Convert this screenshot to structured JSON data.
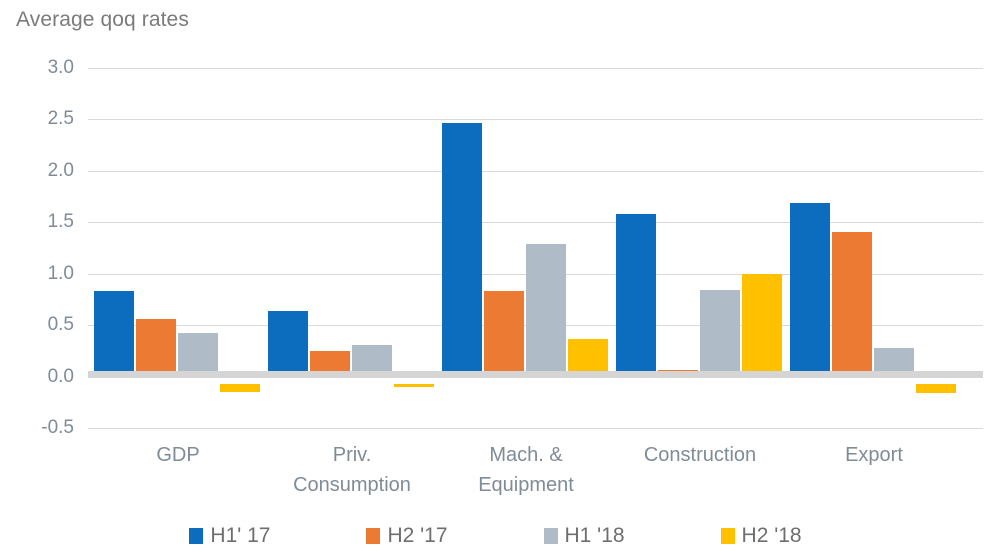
{
  "chart_data": {
    "type": "bar",
    "title": "Average qoq rates",
    "xlabel": "",
    "ylabel": "",
    "ylim": [
      -0.5,
      3.0
    ],
    "ytick_step": 0.5,
    "yticks": [
      "3.0",
      "2.5",
      "2.0",
      "1.5",
      "1.0",
      "0.5",
      "0.0",
      "-0.5"
    ],
    "ytick_values": [
      3.0,
      2.5,
      2.0,
      1.5,
      1.0,
      0.5,
      0.0,
      -0.5
    ],
    "grid": true,
    "legend_position": "bottom",
    "categories": [
      "GDP",
      "Priv.\nConsumption",
      "Mach. &\nEquipment",
      "Construction",
      "Export"
    ],
    "series": [
      {
        "name": "H1' 17",
        "color": "#0C6DBE",
        "values": [
          0.83,
          0.64,
          2.47,
          1.58,
          1.69
        ]
      },
      {
        "name": "H2 '17",
        "color": "#EC7A32",
        "values": [
          0.56,
          0.25,
          0.83,
          0.06,
          1.41
        ]
      },
      {
        "name": "H1 '18",
        "color": "#AFBBC7",
        "values": [
          0.42,
          0.31,
          1.29,
          0.84,
          0.28
        ]
      },
      {
        "name": "H2 '18",
        "color": "#FFC000",
        "values": [
          -0.08,
          -0.03,
          0.37,
          1.0,
          -0.09
        ]
      }
    ]
  },
  "style": {
    "axis_text_color": "#7f8c97",
    "title_color": "#7b7b7b",
    "gridline_color": "#d9d9d9",
    "zero_band_color": "#d5d5d5",
    "legend_text_color": "#6e6e6e",
    "background": "#ffffff"
  }
}
